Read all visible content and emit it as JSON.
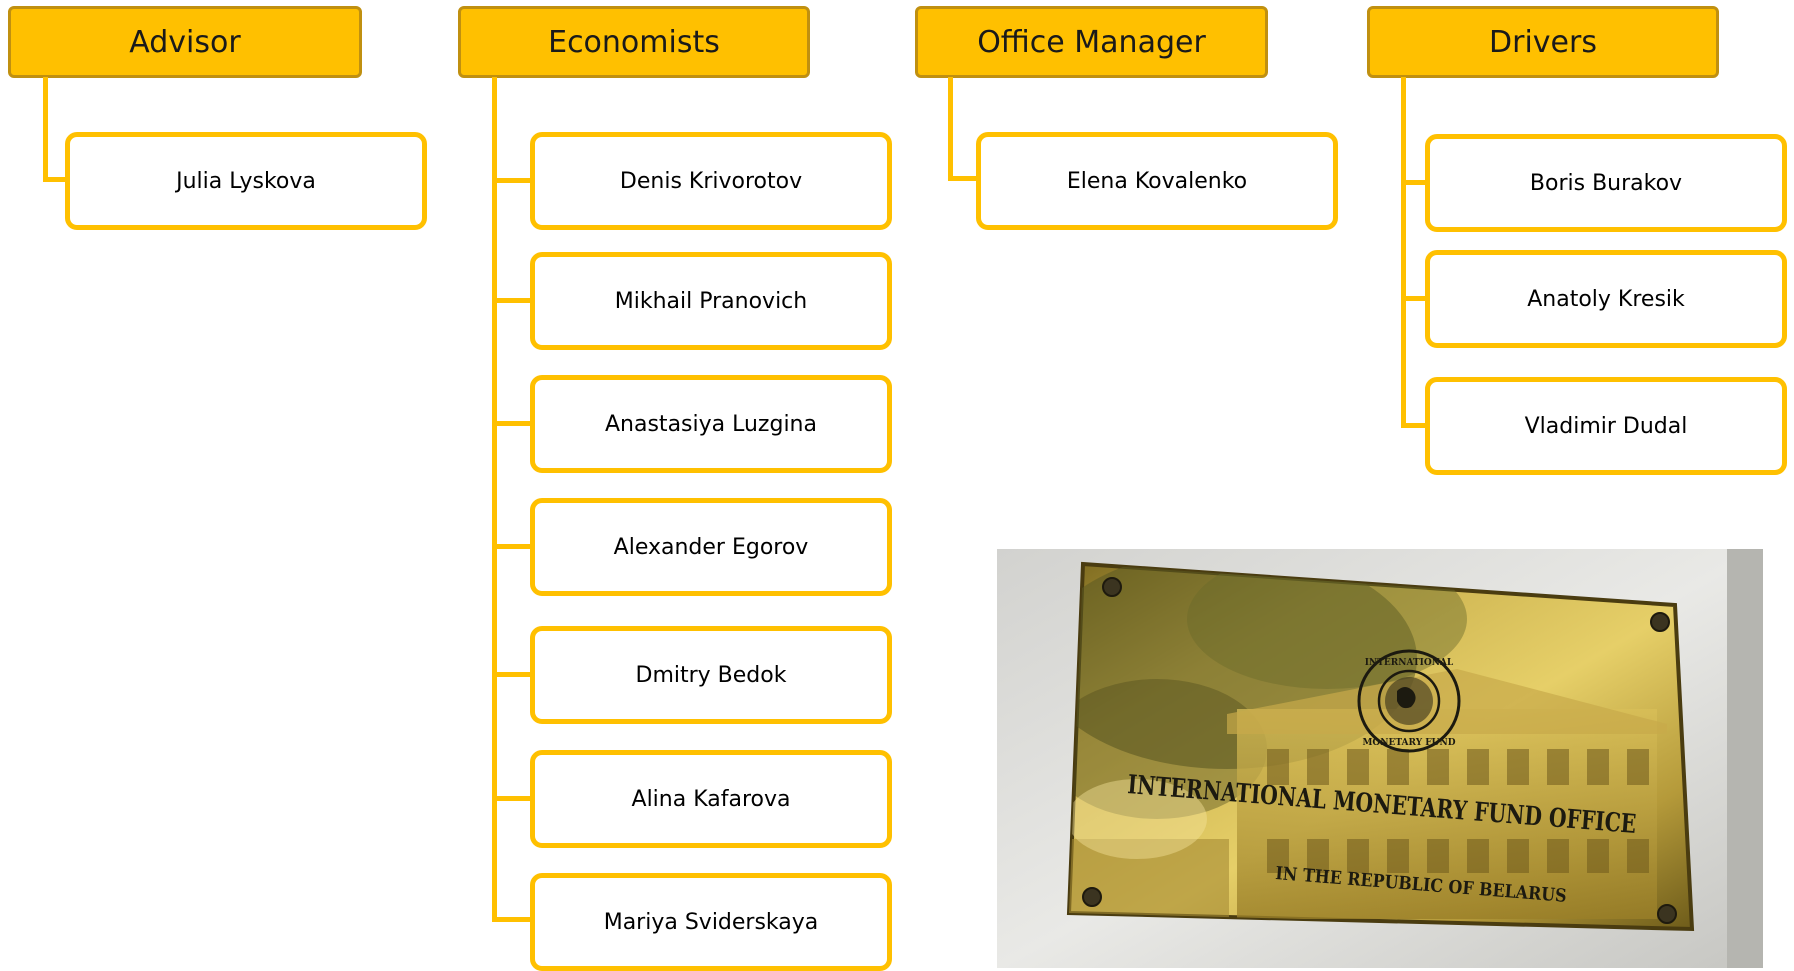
{
  "colors": {
    "header_fill": "#ffc000",
    "header_border": "#c09010",
    "card_border": "#ffc000",
    "connector": "#ffc000"
  },
  "groups": [
    {
      "title": "Advisor",
      "members": [
        "Julia Lyskova"
      ]
    },
    {
      "title": "Economists",
      "members": [
        "Denis Krivorotov",
        "Mikhail Pranovich",
        "Anastasiya Luzgina",
        "Alexander Egorov",
        "Dmitry Bedok",
        "Alina Kafarova",
        "Mariya Sviderskaya"
      ]
    },
    {
      "title": "Office Manager",
      "members": [
        "Elena Kovalenko"
      ]
    },
    {
      "title": "Drivers",
      "members": [
        "Boris Burakov",
        "Anatoly Kresik",
        "Vladimir Dudal"
      ]
    }
  ],
  "photo": {
    "kind": "brass-plaque-photo",
    "plaque_line_1": "INTERNATIONAL MONETARY FUND OFFICE",
    "plaque_line_2": "IN THE REPUBLIC OF BELARUS",
    "seal_text_top": "INTERNATIONAL",
    "seal_text_bottom": "MONETARY FUND"
  }
}
